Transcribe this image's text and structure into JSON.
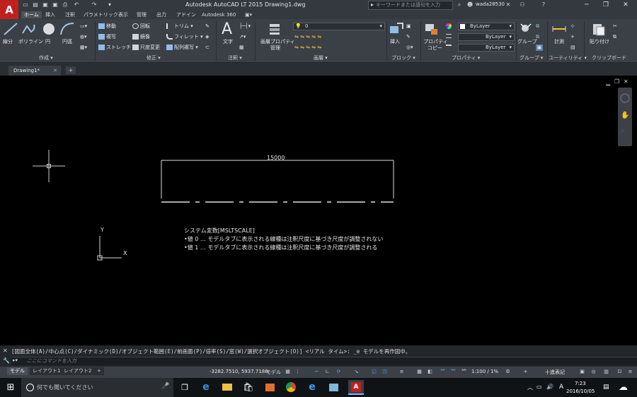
{
  "titlebar": {
    "doc_title": "Autodesk AutoCAD LT 2015   Drawing1.dwg",
    "search_placeholder": "キーワードまたは語句を入力",
    "user": "wada28530",
    "app_logo": "A",
    "app_logo_sub": "LT"
  },
  "menus": [
    "ホーム",
    "挿入",
    "注釈",
    "パラメトリック",
    "表示",
    "管理",
    "出力",
    "アドイン",
    "Autodesk 360"
  ],
  "ribbon": {
    "create": {
      "label": "作成 ▾",
      "line": "線分",
      "polyline": "ポリライン",
      "circle": "円",
      "arc": "円弧"
    },
    "modify": {
      "label": "修正 ▾",
      "move": "移動",
      "rotate": "回転",
      "trim": "トリム",
      "copy": "複写",
      "mirror": "鏡像",
      "fillet": "フィレット",
      "stretch": "ストレッチ",
      "scale": "尺度変更",
      "array": "配列複写"
    },
    "annotation": {
      "label": "注釈 ▾",
      "text": "文字"
    },
    "layers": {
      "label": "画層 ▾",
      "layer_props_1": "画層プロパティ",
      "layer_props_2": "管理",
      "current_layer": "0"
    },
    "block": {
      "label": "ブロック ▾",
      "insert": "挿入"
    },
    "properties": {
      "label": "プロパティ ▾",
      "match_1": "プロパティ",
      "match_2": "コピー",
      "color": "ByLayer",
      "linetype": "ByLayer",
      "lineweight": "ByLayer"
    },
    "groups": {
      "label": "グループ ▾",
      "group": "グループ"
    },
    "utilities": {
      "label": "ユーティリティ ▾",
      "measure": "計測"
    },
    "clipboard": {
      "label": "クリップボード",
      "paste": "貼り付け"
    }
  },
  "tabs": {
    "drawing": "Drawing1*",
    "add": "+"
  },
  "drawing": {
    "dimension_text": "15000",
    "axis_y": "Y",
    "axis_x": "X",
    "note_title": "システム変数[MSLTSCALE]",
    "note_line1": "•値 0 … モデルタブに表示される線種は注釈尺度に基づき尺度が調整されない",
    "note_line2": "•値 1 … モデルタブに表示される線種は注釈尺度に基づき尺度が調整される"
  },
  "command": {
    "history": "[図面全体(A)/中心点(C)/ダイナミック(D)/オブジェクト範囲(E)/前画面(P)/倍率(S)/窓(W)/選択オブジェクト(O)] <リアル タイム>: _e モデルを再作図中。",
    "placeholder": "ここにコマンドを入力"
  },
  "layout_tabs": [
    "モデル",
    "レイアウト1",
    "レイアウト2",
    "+"
  ],
  "status": {
    "coords": "-3282.7510, 5937.7186",
    "model": "モデル",
    "scale": "1:100 / 1%",
    "decimal": "十進表記"
  },
  "taskbar": {
    "search": "何でも聞いてください",
    "time": "7:23",
    "date": "2016/10/05",
    "ime": "A"
  },
  "colors": {
    "accent": "#c0201e",
    "ribbon": "#3b4046",
    "canvas": "#000000"
  }
}
